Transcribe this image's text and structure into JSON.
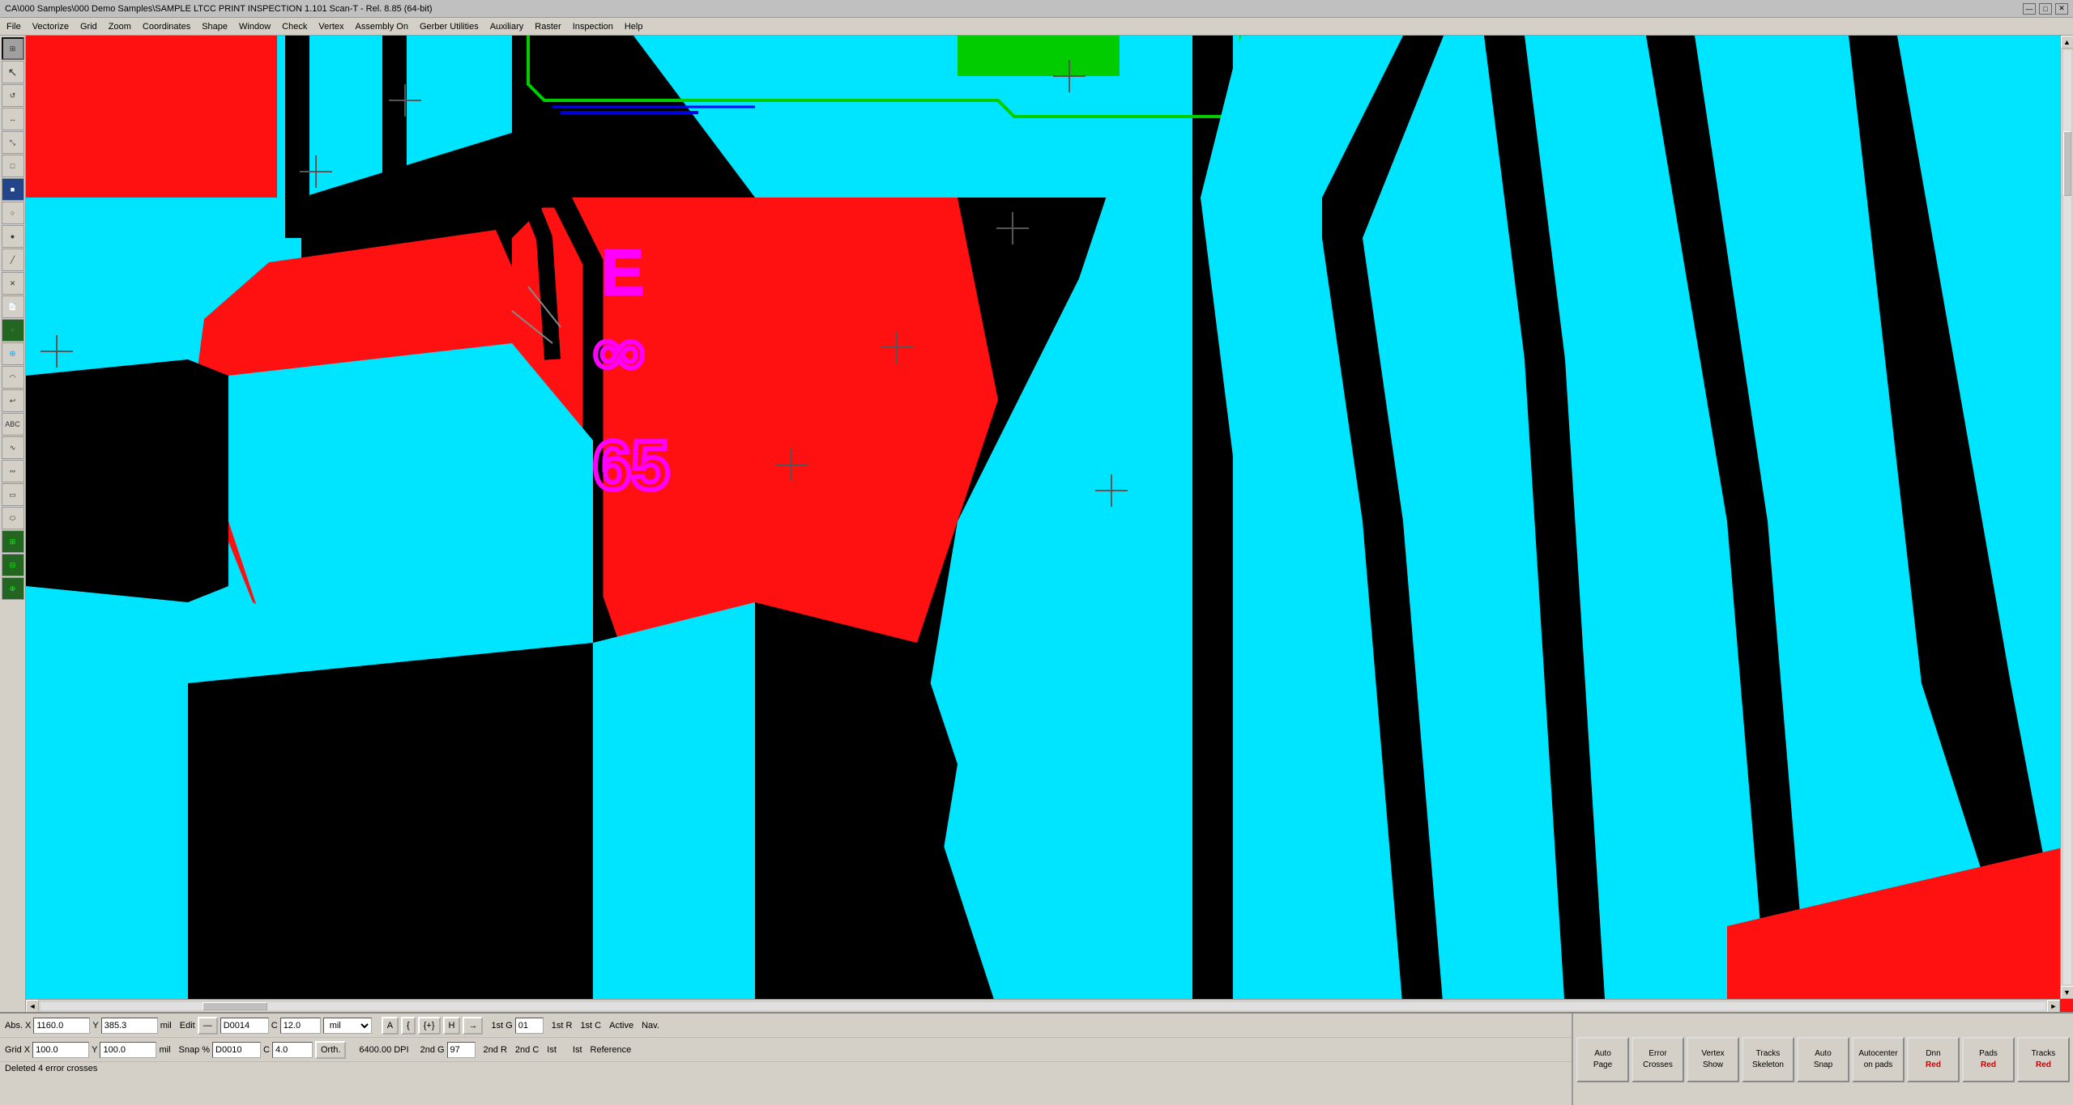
{
  "titlebar": {
    "title": "CA\\000 Samples\\000 Demo Samples\\SAMPLE LTCC PRINT INSPECTION 1.101  Scan-T - Rel. 8.85 (64-bit)",
    "minimize": "—",
    "maximize": "□",
    "close": "✕"
  },
  "menubar": {
    "items": [
      "File",
      "Vectorize",
      "Grid",
      "Zoom",
      "Coordinates",
      "Shape",
      "Window",
      "Check",
      "Vertex",
      "Assembly On",
      "Gerber Utilities",
      "Auxiliary",
      "Raster",
      "Inspection",
      "Help"
    ]
  },
  "toolbar": {
    "tools": [
      {
        "name": "grid-icon",
        "symbol": "⊞"
      },
      {
        "name": "select-icon",
        "symbol": "↖"
      },
      {
        "name": "rotate-icon",
        "symbol": "↺"
      },
      {
        "name": "mirror-icon",
        "symbol": "↔"
      },
      {
        "name": "scale-icon",
        "symbol": "⤡"
      },
      {
        "name": "rect-icon",
        "symbol": "□"
      },
      {
        "name": "fill-rect-icon",
        "symbol": "■"
      },
      {
        "name": "circle-icon",
        "symbol": "○"
      },
      {
        "name": "fill-circle-icon",
        "symbol": "●"
      },
      {
        "name": "line-icon",
        "symbol": "╱"
      },
      {
        "name": "eraser-icon",
        "symbol": "✕"
      },
      {
        "name": "page-icon",
        "symbol": "📄"
      },
      {
        "name": "grid-dots-icon",
        "symbol": "⁘"
      },
      {
        "name": "measure-icon",
        "symbol": "⊕"
      },
      {
        "name": "arc-icon",
        "symbol": "◠"
      },
      {
        "name": "undo-icon",
        "symbol": "↩"
      },
      {
        "name": "text-icon",
        "symbol": "ABC"
      },
      {
        "name": "curve-icon",
        "symbol": "∿"
      },
      {
        "name": "curve2-icon",
        "symbol": "∾"
      },
      {
        "name": "rect2-icon",
        "symbol": "▭"
      },
      {
        "name": "ellipse-icon",
        "symbol": "⬭"
      },
      {
        "name": "pattern-icon",
        "symbol": "⊞"
      },
      {
        "name": "pattern2-icon",
        "symbol": "⊟"
      },
      {
        "name": "zoom-icon",
        "symbol": "⊕"
      }
    ]
  },
  "status": {
    "row1": {
      "abs_label": "Abs.",
      "x_label": "X",
      "x_value": "1160.0",
      "y_label": "Y",
      "y_value": "385.3",
      "unit1": "mil",
      "edit_label": "Edit",
      "dash": "—",
      "aperture": "D0014",
      "c_label": "C",
      "aperture_val": "12.0",
      "unit2": "mil",
      "a_btn": "A",
      "bracket_open": "{",
      "t_btn": "{+}",
      "h_btn": "H",
      "arrow": "→",
      "g1_label": "1st G",
      "g1_val": "01",
      "r1_label": "1st R",
      "c1_label": "1st C",
      "active_label": "Active",
      "nav_label": "Nav."
    },
    "row2": {
      "grid_label": "Grid",
      "x_label": "X",
      "x_value": "100.0",
      "y_label": "Y",
      "y_value": "100.0",
      "unit": "mil",
      "snap_label": "Snap",
      "pct": "%",
      "aperture2": "D0010",
      "c_label": "C",
      "aperture2_val": "4.0",
      "orth_btn": "Orth.",
      "dpi_label": "6400.00 DPI",
      "g2_label": "2nd G",
      "g2_val": "97",
      "r2_label": "2nd R",
      "c2_label": "2nd C",
      "reference_label": "Reference"
    },
    "row3": {
      "message": "Deleted 4 error crosses"
    }
  },
  "right_buttons": [
    {
      "name": "auto-page-btn",
      "line1": "Auto",
      "line2": "Page",
      "red": false
    },
    {
      "name": "error-crosses-btn",
      "line1": "Error",
      "line2": "Crosses",
      "red": false
    },
    {
      "name": "vertex-show-btn",
      "line1": "Vertex",
      "line2": "Show",
      "red": false
    },
    {
      "name": "tracks-skeleton-btn",
      "line1": "Tracks",
      "line2": "Skeleton",
      "red": false
    },
    {
      "name": "auto-snap-btn",
      "line1": "Auto",
      "line2": "Snap",
      "red": false
    },
    {
      "name": "autocenter-on-pads-btn",
      "line1": "Autocenter",
      "line2": "on pads",
      "red": false
    },
    {
      "name": "dnn-red-btn",
      "line1": "Dnn",
      "line2": "Red",
      "red": true
    },
    {
      "name": "pads-red-btn",
      "line1": "Pads",
      "line2": "Red",
      "red": true
    },
    {
      "name": "tracks-red-btn",
      "line1": "Tracks",
      "line2": "Red",
      "red": true
    }
  ],
  "crosshairs": [
    {
      "top": "70",
      "left": "470"
    },
    {
      "top": "150",
      "left": "355"
    },
    {
      "top": "370",
      "left": "38"
    },
    {
      "top": "230",
      "left": "1220"
    },
    {
      "top": "370",
      "left": "1075"
    },
    {
      "top": "510",
      "left": "945"
    },
    {
      "top": "555",
      "left": "1340"
    },
    {
      "top": "42",
      "left": "1290"
    }
  ],
  "colors": {
    "cyan": "#00e5ff",
    "red": "#ff1111",
    "black": "#000000",
    "green": "#00cc00",
    "magenta": "#ff00ff",
    "dark_cyan": "#008b8b",
    "bg": "#000000"
  },
  "ist_labels": [
    {
      "top": "1245",
      "left": "1279",
      "text": "Ist"
    },
    {
      "top": "1243",
      "left": "1490",
      "text": "Ist"
    }
  ]
}
